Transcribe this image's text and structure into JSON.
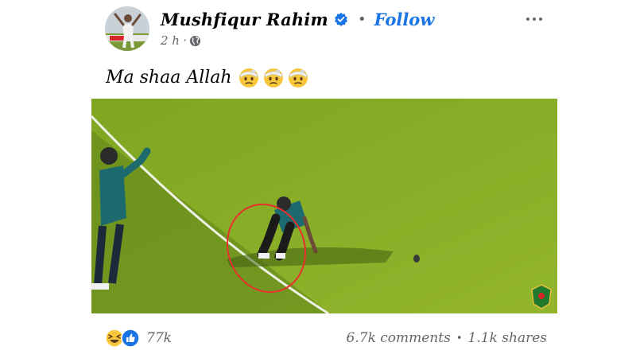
{
  "post": {
    "author": "Mushfiqur Rahim",
    "follow_label": "Follow",
    "separator": "•",
    "time": "2 h",
    "time_separator": "·",
    "privacy_icon": "globe-icon",
    "verified_icon": "verified-badge-icon",
    "more_icon": "more-options-icon",
    "caption": "Ma shaa Allah",
    "caption_emojis": [
      "face-with-head-bandage",
      "face-with-head-bandage",
      "face-with-head-bandage"
    ]
  },
  "media": {
    "alt_description_icon": "cricket-video-frame",
    "watermark_icon": "bcb-logo-icon"
  },
  "footer": {
    "reactions": [
      "haha-icon",
      "like-icon"
    ],
    "reaction_count": "77k",
    "comments": "6.7k comments",
    "sep": "•",
    "shares": "1.1k shares"
  },
  "colors": {
    "accent": "#1b74e4",
    "secondary_text": "#65676b",
    "pitch_green": "#86ad25",
    "annotation_red": "#e8302c"
  }
}
